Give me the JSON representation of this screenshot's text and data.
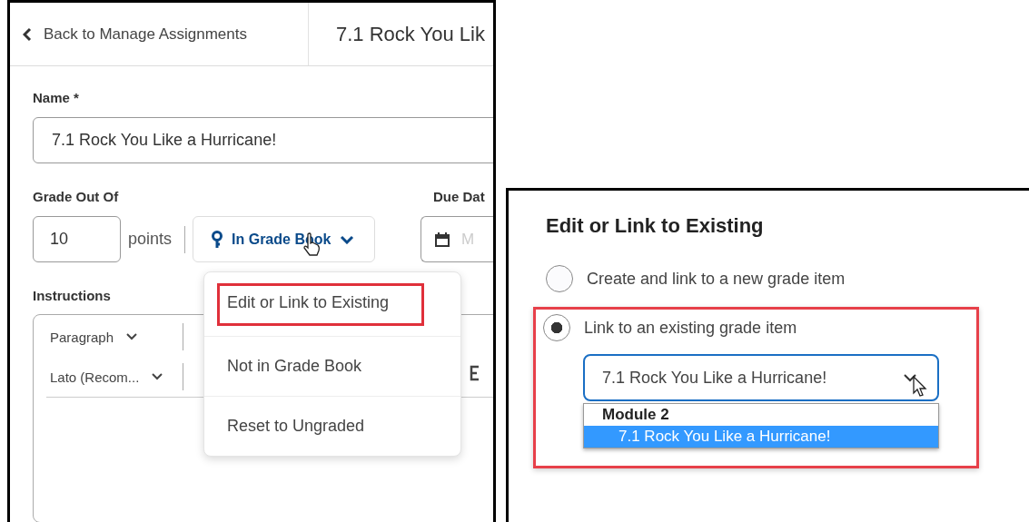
{
  "back_link": {
    "label": "Back to Manage Assignments"
  },
  "page_title": "7.1 Rock You Lik",
  "name_field": {
    "label": "Name *",
    "value": "7.1 Rock You Like a Hurricane!"
  },
  "grade": {
    "label": "Grade Out Of",
    "value": "10",
    "unit": "points",
    "gradebook_button": "In Grade Book"
  },
  "due_date": {
    "label": "Due Dat",
    "placeholder": "M"
  },
  "instructions": {
    "label": "Instructions",
    "toolbar": [
      {
        "label": "Paragraph"
      },
      {
        "label": "Lato (Recom..."
      }
    ]
  },
  "grade_menu": {
    "items": [
      {
        "label": "Edit or Link to Existing",
        "highlighted": true
      },
      {
        "label": "Not in Grade Book",
        "highlighted": false
      },
      {
        "label": "Reset to Ungraded",
        "highlighted": false
      }
    ]
  },
  "dialog": {
    "title": "Edit or Link to Existing",
    "options": [
      {
        "label": "Create and link to a new grade item",
        "selected": false
      },
      {
        "label": "Link to an existing grade item",
        "selected": true
      }
    ],
    "select": {
      "value": "7.1 Rock You Like a Hurricane!",
      "expanded": true,
      "groups": [
        {
          "label": "Module 2",
          "options": [
            {
              "label": "7.1 Rock You Like a Hurricane!",
              "selected": true
            }
          ]
        }
      ]
    }
  }
}
